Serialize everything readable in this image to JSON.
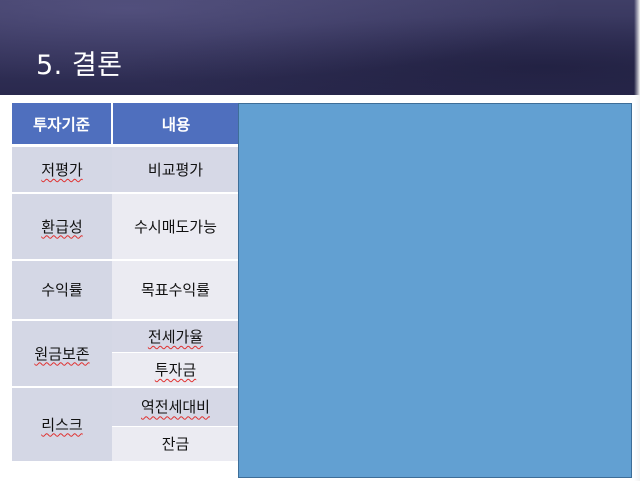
{
  "slide": {
    "title": "5. 결론"
  },
  "table": {
    "header": {
      "criterion": "투자기준",
      "content": "내용"
    },
    "rows": {
      "r0": {
        "category": "저평가",
        "value": "비교평가"
      },
      "r1": {
        "category": "환급성",
        "value": "수시매도가능"
      },
      "r2": {
        "category": "수익률",
        "value": "목표수익률"
      },
      "r3": {
        "category": "원금보존",
        "value_a": "전세가율",
        "value_b": "투자금"
      },
      "r4": {
        "category": "리스크",
        "value_a": "역전세대비",
        "value_b": "잔금"
      }
    }
  },
  "colors": {
    "header_band": "#34335a",
    "table_header": "#4f6fbe",
    "category_cell": "#d4d7e5",
    "value_light": "#ebebf2",
    "placeholder_panel": "#62a0d2",
    "spellcheck_mark": "#e0302f"
  }
}
